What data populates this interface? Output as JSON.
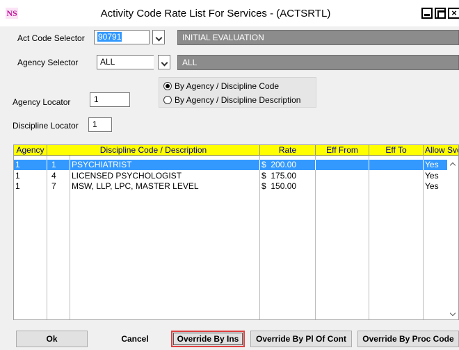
{
  "window": {
    "title": "Activity Code Rate List For Services - (ACTSRTL)",
    "app_icon_text": "NS",
    "close_glyph": "×"
  },
  "act_code": {
    "label": "Act Code Selector",
    "value": "90791",
    "description": "INITIAL EVALUATION"
  },
  "agency": {
    "label": "Agency Selector",
    "value": "ALL",
    "description": "ALL"
  },
  "sort_options": [
    {
      "label": "By Agency / Discipline Code",
      "selected": true
    },
    {
      "label": "By Agency / Discipline Description",
      "selected": false
    }
  ],
  "agency_locator": {
    "label": "Agency Locator",
    "value": "1"
  },
  "discipline_locator": {
    "label": "Discipline Locator",
    "value": "1"
  },
  "grid": {
    "columns": [
      "Agency",
      "Discipline Code / Description",
      "Rate",
      "Eff From",
      "Eff To",
      "Allow Svc"
    ],
    "rows": [
      {
        "agency": "1",
        "code": "1",
        "description": "PSYCHIATRIST",
        "currency": "$",
        "rate": "200.00",
        "eff_from": "",
        "eff_to": "",
        "allow": "Yes",
        "selected": true
      },
      {
        "agency": "1",
        "code": "4",
        "description": "LICENSED PSYCHOLOGIST",
        "currency": "$",
        "rate": "175.00",
        "eff_from": "",
        "eff_to": "",
        "allow": "Yes",
        "selected": false
      },
      {
        "agency": "1",
        "code": "7",
        "description": "MSW,  LLP, LPC, MASTER LEVEL",
        "currency": "$",
        "rate": "150.00",
        "eff_from": "",
        "eff_to": "",
        "allow": "Yes",
        "selected": false
      }
    ]
  },
  "buttons": {
    "ok": "Ok",
    "cancel": "Cancel",
    "override_ins": "Override By Ins",
    "override_pl": "Override By Pl Of Cont",
    "override_proc": "Override By Proc Code"
  },
  "colors": {
    "grid_header_bg": "#ffff00",
    "grid_header_text": "#00008b",
    "selection": "#3399ff",
    "description_field_bg": "#8c8c8c",
    "focus_border": "#e04040"
  }
}
